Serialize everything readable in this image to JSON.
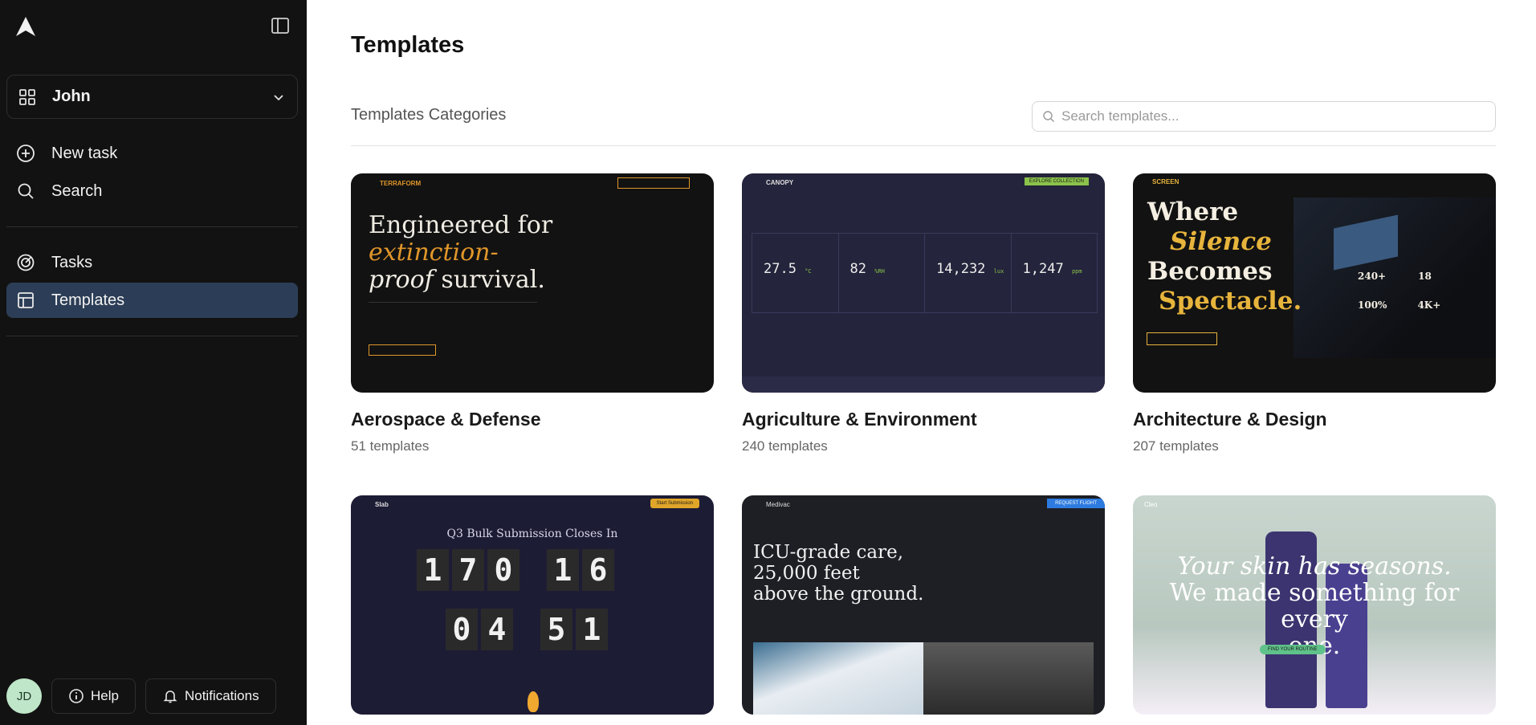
{
  "sidebar": {
    "workspace_name": "John",
    "nav": {
      "new_task": "New task",
      "search": "Search",
      "tasks": "Tasks",
      "templates": "Templates"
    },
    "user_initials": "JD",
    "help_label": "Help",
    "notifications_label": "Notifications"
  },
  "main": {
    "title": "Templates",
    "categories_label": "Templates Categories",
    "search_placeholder": "Search templates...",
    "cards": [
      {
        "title": "Aerospace & Defense",
        "count": "51 templates",
        "thumb": {
          "brand": "TERRAFORM",
          "headline_1": "Engineered for",
          "headline_2": "extinction-",
          "headline_3a": "proof",
          "headline_3b": " survival."
        }
      },
      {
        "title": "Agriculture & Environment",
        "count": "240 templates",
        "thumb": {
          "brand": "CANOPY",
          "cta": "EXPLORE COLLECTION",
          "stats": [
            "27.5",
            "82",
            "14,232",
            "1,247"
          ],
          "units": [
            "°C",
            "%RH",
            "lux",
            "ppm"
          ]
        }
      },
      {
        "title": "Architecture & Design",
        "count": "207 templates",
        "thumb": {
          "brand": "SCREEN",
          "line1": "Where",
          "line2": "Silence",
          "line3": "Becomes",
          "line4": "Spectacle.",
          "stats": [
            "240+",
            "18",
            "100%",
            "4K+"
          ]
        }
      },
      {
        "title": "",
        "count": "",
        "thumb": {
          "brand": "Slab",
          "cta": "Start Submission",
          "headline": "Q3 Bulk Submission Closes In",
          "digits_top": [
            "1",
            "7",
            "0",
            "1",
            "6"
          ],
          "digits_bottom": [
            "0",
            "4",
            "5",
            "1"
          ]
        }
      },
      {
        "title": "",
        "count": "",
        "thumb": {
          "brand": "Medivac",
          "cta": "REQUEST FLIGHT",
          "line1": "ICU-grade care,",
          "line2": "25,000 feet",
          "line3": "above the ground."
        }
      },
      {
        "title": "",
        "count": "",
        "thumb": {
          "brand": "Cleo",
          "line1": "Your skin has seasons.",
          "line2": "We made something for every",
          "line3": "one.",
          "cta": "FIND YOUR ROUTINE"
        }
      }
    ]
  },
  "colors": {
    "sidebar_bg": "#121212",
    "active_nav_bg": "#2c3e57",
    "accent_orange": "#e0962a",
    "accent_gold": "#e7b43c",
    "avatar_bg": "#bfe6c8"
  }
}
